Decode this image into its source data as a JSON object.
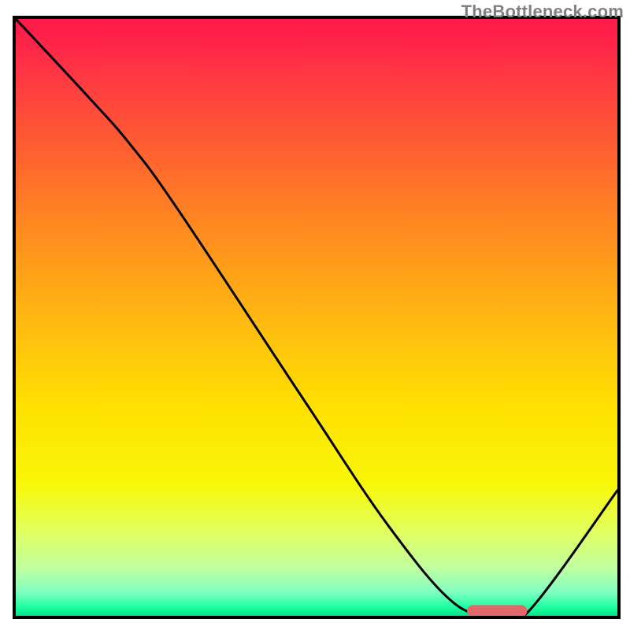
{
  "watermark": "TheBottleneck.com",
  "chart_data": {
    "type": "line",
    "title": "",
    "xlabel": "",
    "ylabel": "",
    "xlim": [
      0,
      100
    ],
    "ylim": [
      0,
      100
    ],
    "axes_visible": false,
    "grid": false,
    "background": {
      "type": "vertical-gradient",
      "stops": [
        {
          "pos": 0.0,
          "color": "#ff1a4a"
        },
        {
          "pos": 0.05,
          "color": "#ff2848"
        },
        {
          "pos": 0.12,
          "color": "#ff4040"
        },
        {
          "pos": 0.22,
          "color": "#ff6030"
        },
        {
          "pos": 0.35,
          "color": "#ff8a20"
        },
        {
          "pos": 0.5,
          "color": "#ffb812"
        },
        {
          "pos": 0.65,
          "color": "#ffe000"
        },
        {
          "pos": 0.78,
          "color": "#f8f808"
        },
        {
          "pos": 0.86,
          "color": "#e0ff60"
        },
        {
          "pos": 0.92,
          "color": "#c0ffa0"
        },
        {
          "pos": 0.96,
          "color": "#80ffc0"
        },
        {
          "pos": 0.985,
          "color": "#20ffa0"
        },
        {
          "pos": 1.0,
          "color": "#00e688"
        }
      ]
    },
    "series": [
      {
        "name": "curve",
        "color": "#000000",
        "stroke_width": 3,
        "x": [
          0.0,
          12.0,
          19.0,
          27.0,
          48.0,
          62.0,
          73.0,
          80.0,
          85.0,
          100.0
        ],
        "y": [
          100.0,
          87.0,
          79.0,
          68.0,
          36.0,
          15.0,
          2.0,
          0.5,
          0.5,
          21.0
        ]
      }
    ],
    "marker": {
      "name": "optimal-range",
      "shape": "rounded-bar",
      "color": "#e06868",
      "x_start": 75.0,
      "x_end": 85.0,
      "y": 0.8,
      "thickness_pct": 2.0
    },
    "frame": {
      "color": "#000000",
      "width": 4
    }
  }
}
